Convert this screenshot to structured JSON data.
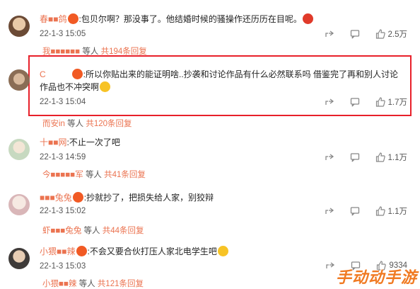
{
  "comments": [
    {
      "name": "春■■鸽",
      "text": "包贝尔啊？那没事了。他结婚时候的骚操作还历历在目呢。",
      "time": "22-1-3 15:05",
      "likes": "2.5万",
      "reply_user": "我■■■■■■",
      "reply_others": "等人",
      "reply_count": "共194条回复"
    },
    {
      "name": "C",
      "text": "所以你贴出来的能证明啥..抄袭和讨论作品有什么必然联系吗 借鉴完了再和别人讨论作品也不冲突啊",
      "time": "22-1-3 15:04",
      "likes": "1.7万",
      "reply_user": "而安in",
      "reply_others": "等人",
      "reply_count": "共120条回复"
    },
    {
      "name": "十■■网",
      "text": "不止一次了吧",
      "time": "22-1-3 14:59",
      "likes": "1.1万",
      "reply_user": "今■■■■■军",
      "reply_others": "等人",
      "reply_count": "共41条回复"
    },
    {
      "name": "■■■兔兔",
      "text": "抄就抄了，把损失给人家，别狡辩",
      "time": "22-1-3 15:02",
      "likes": "1.1万",
      "reply_user": "虾■■■兔兔",
      "reply_others": "等人",
      "reply_count": "共44条回复"
    },
    {
      "name": "小猥■■辣",
      "text": "不会又要合伙打压人家北电学生吧",
      "time": "22-1-3 15:03",
      "likes": "9334",
      "reply_user": "小猥■■辣",
      "reply_others": "等人",
      "reply_count": "共121条回复"
    }
  ],
  "watermark": "手动动手游",
  "colors": {
    "highlight": "#e8202a",
    "name": "#eb7350"
  }
}
